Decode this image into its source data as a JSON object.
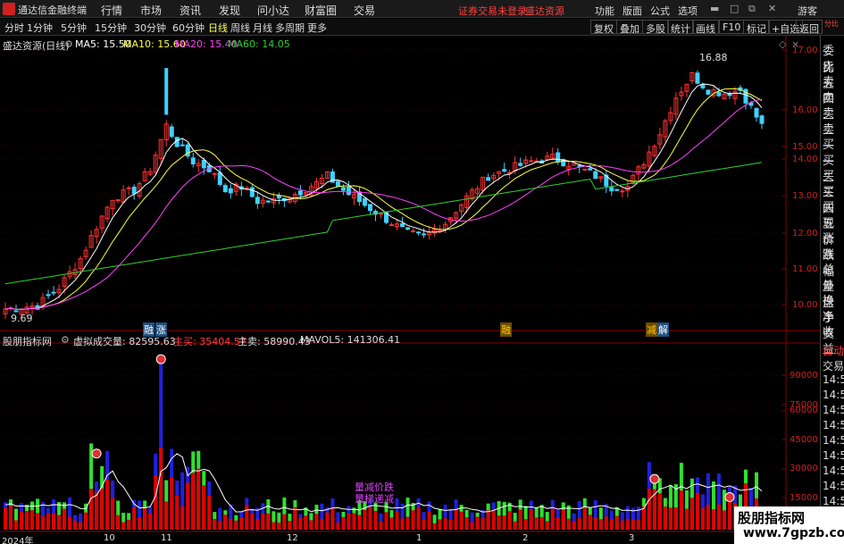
{
  "menubar": {
    "app_name": "通达信金融终端",
    "items": [
      "行情",
      "市场",
      "资讯",
      "发现",
      "问小达",
      "财富圈",
      "交易"
    ],
    "login_status": "证券交易未登录",
    "stock_tag": "盛达资源",
    "right_items": [
      "功能",
      "版面",
      "公式",
      "选项"
    ],
    "guest": "游客"
  },
  "toolbar": {
    "periods": [
      "分时",
      "1分钟",
      "5分钟",
      "15分钟",
      "30分钟",
      "60分钟",
      "日线",
      "周线",
      "月线",
      "多周期",
      "更多"
    ],
    "active_period": "日线",
    "right_buttons": [
      "复权",
      "叠加",
      "多股",
      "统计",
      "画线",
      "F10",
      "标记",
      "+自选",
      "返回"
    ]
  },
  "main_chart": {
    "title": "盛达资源(日线)",
    "ma5_label": "MA5: 15.50",
    "ma10_label": "MA10: 15.60",
    "ma20_label": "MA20: 15.40",
    "ma60_label": "MA60: 14.05",
    "high_marker": "16.88",
    "low_marker": "9.69",
    "event_tags": [
      "融",
      "涨",
      "融",
      "减",
      "解"
    ]
  },
  "sub_chart": {
    "title": "股朋指标网",
    "vol_label": "虚拟成交量: 82595.63",
    "main_buy_label": "主买: 35404.57",
    "main_sell_label": "主卖: 58990.43",
    "mavol_label": "MAVOL5: 141306.41",
    "annotation1": "量减价跌",
    "annotation2": "量梯递减"
  },
  "side_panel": {
    "labels": [
      "委比",
      "卖五",
      "卖四",
      "卖三",
      "卖二",
      "卖一",
      "买一",
      "买二",
      "买三",
      "买四",
      "买五",
      "现价",
      "涨跌",
      "涨幅",
      "总量",
      "外盘",
      "换手",
      "净资",
      "收益"
    ],
    "labels2": [
      "自动",
      "交易",
      "14:5",
      "14:5",
      "14:5",
      "14:5",
      "14:5",
      "14:5",
      "14:5",
      "14:5",
      "14:5"
    ],
    "top_label": "分比"
  },
  "chart_data": {
    "type": "candlestick",
    "y_ticks_price": [
      "17.00",
      "16.00",
      "15.00",
      "14.00",
      "13.00",
      "12.00",
      "11.00",
      "10.00"
    ],
    "y_ticks_volume": [
      "90000",
      "75000",
      "60000",
      "45000",
      "30000",
      "15000"
    ],
    "x_labels": [
      "2024年",
      "10",
      "11",
      "12",
      "1",
      "2",
      "3"
    ],
    "price_range": [
      9.6,
      17.2
    ],
    "volume_range": [
      0,
      95000
    ]
  },
  "colors": {
    "up": "#ff3232",
    "down": "#40d0ff",
    "ma5": "#ffffff",
    "ma10": "#ffff40",
    "ma20": "#ff40ff",
    "ma60": "#30d030",
    "vol_red": "#e00000",
    "vol_blue": "#2020e0",
    "vol_green": "#30e030"
  },
  "watermark": {
    "line1": "股朋指标网",
    "line2": "www.7gpzb.com"
  }
}
